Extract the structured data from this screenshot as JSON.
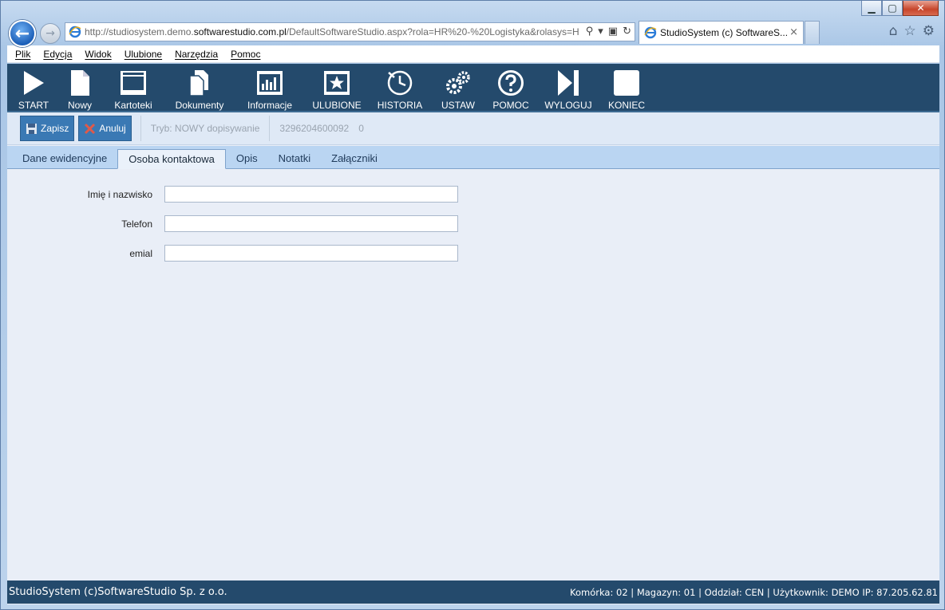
{
  "browser": {
    "url_prefix": "http://studiosystem.demo.",
    "url_host": "softwarestudio.com.pl",
    "url_path": "/DefaultSoftwareStudio.aspx?rola=HR%20-%20Logistyka&rolasys=H",
    "tab_title": "StudioSystem (c) SoftwareS...",
    "tab_close": "×"
  },
  "menu": [
    "Plik",
    "Edycja",
    "Widok",
    "Ulubione",
    "Narzędzia",
    "Pomoc"
  ],
  "toolbar": [
    {
      "label": "START",
      "icon": "play-icon"
    },
    {
      "label": "Nowy",
      "icon": "new-document-icon"
    },
    {
      "label": "Kartoteki",
      "icon": "window-icon"
    },
    {
      "label": "Dokumenty",
      "icon": "documents-icon"
    },
    {
      "label": "Informacje",
      "icon": "bar-chart-icon"
    },
    {
      "label": "ULUBIONE",
      "icon": "star-icon"
    },
    {
      "label": "HISTORIA",
      "icon": "history-icon"
    },
    {
      "label": "USTAW",
      "icon": "gears-icon"
    },
    {
      "label": "POMOC",
      "icon": "help-icon"
    },
    {
      "label": "WYLOGUJ",
      "icon": "logout-icon"
    },
    {
      "label": "KONIEC",
      "icon": "square-icon"
    }
  ],
  "actions": {
    "save_label": "Zapisz",
    "cancel_label": "Anuluj",
    "mode_text": "Tryb: NOWY dopisywanie",
    "record_id": "3296204600092",
    "record_count": "0"
  },
  "tabs": [
    {
      "label": "Dane ewidencyjne",
      "active": false
    },
    {
      "label": "Osoba kontaktowa",
      "active": true
    },
    {
      "label": "Opis",
      "active": false
    },
    {
      "label": "Notatki",
      "active": false
    },
    {
      "label": "Załączniki",
      "active": false
    }
  ],
  "form": {
    "name_label": "Imię i nazwisko",
    "name_value": "",
    "phone_label": "Telefon",
    "phone_value": "",
    "email_label": "emial",
    "email_value": ""
  },
  "status": {
    "left": "StudioSystem (c)SoftwareStudio Sp. z o.o.",
    "right": "Komórka: 02 | Magazyn: 01 | Oddział: CEN | Użytkownik: DEMO IP: 87.205.62.81"
  },
  "colors": {
    "toolbar_bg": "#244a6c",
    "action_button": "#3a79b4",
    "tab_strip": "#bad5f2",
    "panel_bg": "#e9eef7"
  }
}
